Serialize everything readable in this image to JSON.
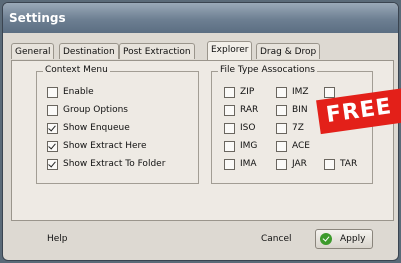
{
  "window": {
    "title": "Settings"
  },
  "tabs": [
    "General",
    "Destination",
    "Post Extraction",
    "Explorer",
    "Drag & Drop"
  ],
  "active_tab": "Explorer",
  "context_menu": {
    "title": "Context Menu",
    "items": [
      {
        "label": "Enable",
        "checked": false
      },
      {
        "label": "Group Options",
        "checked": false
      },
      {
        "label": "Show Enqueue",
        "checked": true
      },
      {
        "label": "Show Extract Here",
        "checked": true
      },
      {
        "label": "Show Extract To Folder",
        "checked": true
      }
    ]
  },
  "file_types": {
    "title": "File Type Assocations",
    "items": [
      {
        "label": "ZIP",
        "checked": false
      },
      {
        "label": "IMZ",
        "checked": false
      },
      {
        "label": "",
        "checked": false
      },
      {
        "label": "RAR",
        "checked": false
      },
      {
        "label": "BIN",
        "checked": false
      },
      {
        "label": "ISO",
        "checked": false
      },
      {
        "label": "7Z",
        "checked": false
      },
      {
        "label": "IMG",
        "checked": false
      },
      {
        "label": "ACE",
        "checked": false
      },
      {
        "label": "IMA",
        "checked": false
      },
      {
        "label": "JAR",
        "checked": false
      },
      {
        "label": "TAR",
        "checked": false
      }
    ]
  },
  "footer": {
    "help": "Help",
    "cancel": "Cancel",
    "apply": "Apply"
  },
  "overlay": {
    "badge": "FREE"
  },
  "colors": {
    "titlebar": "#6d7f92",
    "badge": "#e32019",
    "apply_icon": "#3d9a2c"
  }
}
